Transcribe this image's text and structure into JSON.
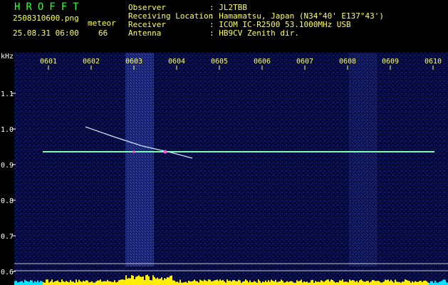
{
  "header": {
    "app_title": "HROFFT",
    "file_name": "2508310600.png",
    "datetime": "25.08.31 06:00",
    "detection_type": "meteor",
    "detection_count": "66",
    "info_rows": [
      {
        "label": "Observer",
        "value": ": JL2TBB"
      },
      {
        "label": "Receiving Location",
        "value": ": Hamamatsu, Japan (N34°40' E137°43')"
      },
      {
        "label": "Receiver",
        "value": ": ICOM IC-R2500 53.1000MHz USB"
      },
      {
        "label": "Antenna",
        "value": ": HB9CV Zenith dir."
      }
    ]
  },
  "spectrogram": {
    "y_unit": "kHz",
    "x_ticks": [
      "0601",
      "0602",
      "0603",
      "0604",
      "0605",
      "0606",
      "0607",
      "0608",
      "0609",
      "0610"
    ],
    "y_ticks": [
      "1.1",
      "1.0",
      "0.9",
      "0.8",
      "0.7",
      "0.6"
    ],
    "colors": {
      "background": "#05083a",
      "carrier": "#7dffb0",
      "meteor_trail": "#cfe8ff",
      "meteor_head": "#ff4fd8",
      "baseline": "#c8c8c8",
      "level_yellow": "#ffee00",
      "level_cyan": "#00e5ff"
    }
  }
}
